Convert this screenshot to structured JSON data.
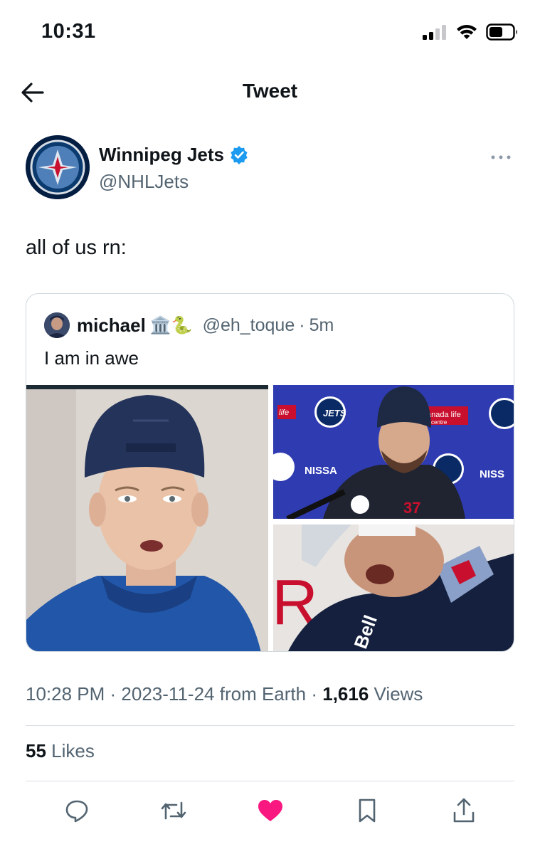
{
  "status": {
    "time": "10:31"
  },
  "nav": {
    "title": "Tweet"
  },
  "tweet": {
    "author": {
      "name": "Winnipeg Jets",
      "handle": "@NHLJets",
      "verified": true
    },
    "text": "all of us rn:",
    "quote": {
      "name": "michael",
      "name_emoji": "🏛️🐍",
      "handle": "@eh_toque",
      "time": "5m",
      "text": "I am in awe",
      "photo_texts": {
        "sponsor_1": "life",
        "logo_1": "JETS",
        "sponsor_2": "NISSA",
        "sponsor_3": "NISS",
        "sponsor_4": "anada life",
        "sponsor_5": "centre",
        "jersey_number": "37",
        "sign_letter": "R",
        "helmet_sponsor": "Bell"
      }
    },
    "meta": {
      "time": "10:28 PM",
      "date": "2023-11-24",
      "source": "from Earth",
      "views_count": "1,616",
      "views_label": "Views"
    },
    "likes": {
      "count": "55",
      "label": "Likes"
    }
  },
  "colors": {
    "like_pink": "#f91880",
    "verified_blue": "#1d9bf0",
    "secondary_text": "#536471",
    "jets_navy": "#041e42"
  },
  "icons": {
    "back": "back-arrow-icon",
    "more": "more-icon",
    "reply": "reply-icon",
    "retweet": "retweet-icon",
    "like": "heart-icon",
    "bookmark": "bookmark-icon",
    "share": "share-icon"
  }
}
